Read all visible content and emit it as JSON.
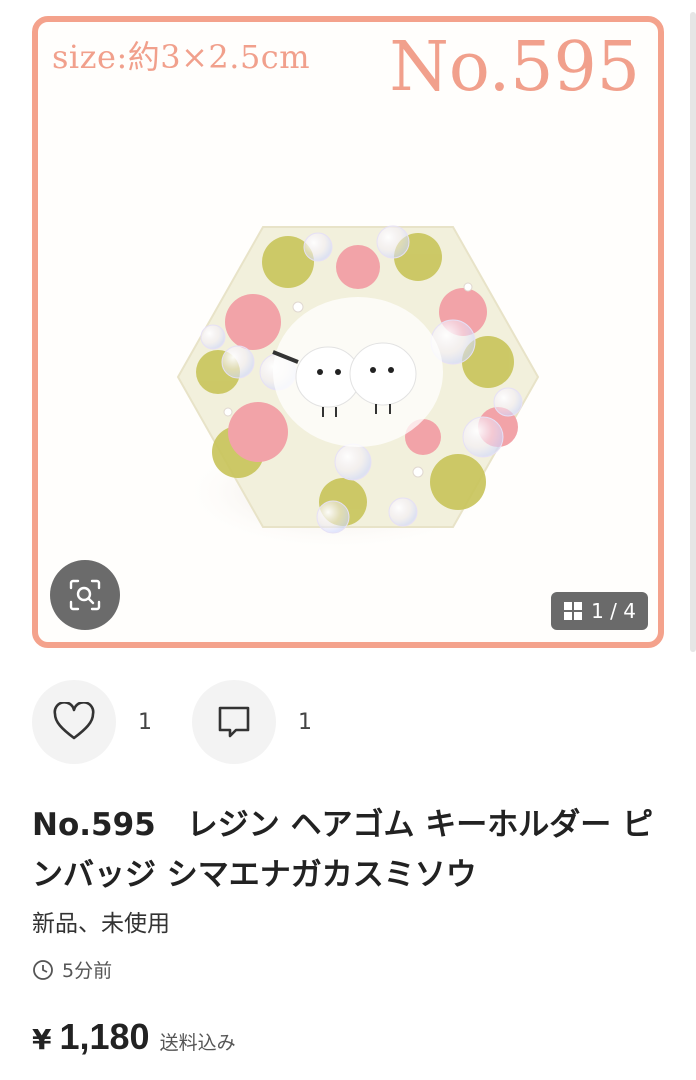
{
  "image": {
    "size_text": "size:約3×2.5cm",
    "number_overlay": "No.595",
    "counter": "1 / 4",
    "zoom_icon": "image-search-icon",
    "counter_icon": "grid-icon"
  },
  "actions": {
    "likes": {
      "icon": "heart-icon",
      "count": "1"
    },
    "comments": {
      "icon": "comment-icon",
      "count": "1"
    }
  },
  "item": {
    "title": "No.595　レジン ヘアゴム キーホルダー ピンバッジ シマエナガカスミソウ",
    "condition": "新品、未使用",
    "posted": "5分前",
    "price_symbol": "¥",
    "price": "1,180",
    "shipping_note": "送料込み"
  },
  "colors": {
    "frame": "#f4a28c",
    "overlay_text": "#f1a08c"
  }
}
